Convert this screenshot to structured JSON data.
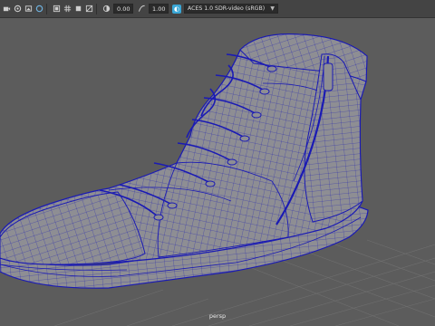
{
  "toolbar": {
    "icons": [
      "camera-icon",
      "bookmark-icon",
      "image-plane-icon",
      "film-gate-icon",
      "resolution-gate-icon",
      "grid-icon",
      "isolate-icon",
      "xray-icon",
      "exposure-icon",
      "gamma-icon",
      "color-management-icon"
    ],
    "exposure_value": "0.00",
    "gamma_value": "1.00",
    "color_space": "ACES 1.0 SDR-video (sRGB)"
  },
  "viewport": {
    "camera_label": "persp",
    "background_color": "#5c5c5c",
    "model_color": "#8e8e93",
    "wire_color": "#1a1ab4"
  }
}
